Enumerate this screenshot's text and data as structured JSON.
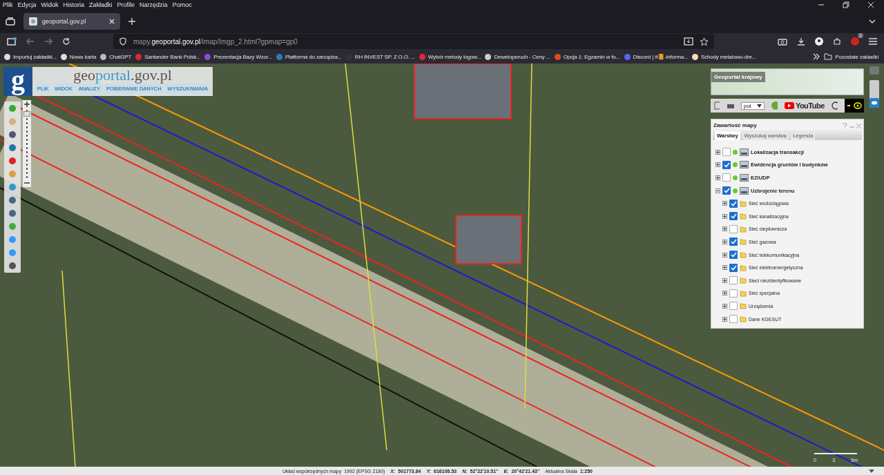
{
  "menu_bar": [
    "Plik",
    "Edycja",
    "Widok",
    "Historia",
    "Zakładki",
    "Profile",
    "Narzędzia",
    "Pomoc"
  ],
  "tabs": [
    {
      "title": "geoportal.gov.pl",
      "selected": true
    }
  ],
  "address_bar": {
    "host_prefix": "mapy.",
    "host": "geoportal.gov.pl",
    "path": "/imap/Imgp_2.html?gpmap=gp0"
  },
  "extension_badge": "2",
  "bookmarks": [
    {
      "label": "Importuj zakładki...",
      "color": "#dddddd"
    },
    {
      "label": "Nowa karta",
      "color": "#dddddd"
    },
    {
      "label": "ChatGPT",
      "color": "#bbbbbb"
    },
    {
      "label": "Santander Bank Polsk...",
      "color": "#e3262b"
    },
    {
      "label": "Prezentacja Bazy Wzor...",
      "color": "#8a4fd8"
    },
    {
      "label": "Platforma do zarządza...",
      "color": "#2a7fb8"
    },
    {
      "label": "RH INVEST SP. Z O.O. ...",
      "color": "#333333"
    },
    {
      "label": "Wybór metody logow...",
      "color": "#e3263b"
    },
    {
      "label": "Deweloperuch - Ceny ...",
      "color": "#cccccc"
    },
    {
      "label": "Opcja 1: Egzamin w fo...",
      "color": "#e64a19"
    },
    {
      "label": "Discord | #📙-informa...",
      "color": "#5865f2"
    },
    {
      "label": "Schody metalowo-dre...",
      "color": "#f0e0b0"
    }
  ],
  "other_bookmarks": "Pozostałe zakładki",
  "geoportal": {
    "logo_letter": "g",
    "site_parts": [
      "geo",
      "portal",
      ".gov.pl"
    ],
    "menu": [
      "PLIK",
      "WIDOK",
      "ANALIZY",
      "POBIERANIE DANYCH",
      "WYSZUKIWANIA"
    ]
  },
  "overview": {
    "title": "Geoportal krajowy",
    "language": "pol",
    "youtube": "YouTube"
  },
  "map_content": {
    "title": "Zawartość mapy",
    "tabs": [
      {
        "label": "Warstwy",
        "selected": true
      },
      {
        "label": "Wyszukaj warstwę",
        "selected": false
      },
      {
        "label": "Legenda",
        "selected": false
      }
    ],
    "layers": [
      {
        "name": "Lokalizacja transakcji",
        "checked": false,
        "expanded": false
      },
      {
        "name": "Ewidencja gruntów i budynków",
        "checked": true,
        "expanded": false
      },
      {
        "name": "EZiUDP",
        "checked": false,
        "expanded": false
      },
      {
        "name": "Uzbrojenie terenu",
        "checked": true,
        "expanded": true,
        "children": [
          {
            "name": "Sieć wodociągowa",
            "checked": true,
            "expanded": false
          },
          {
            "name": "Sieć kanalizacyjna",
            "checked": true,
            "expanded": false
          },
          {
            "name": "Sieć ciepłownicza",
            "checked": false,
            "expanded": false
          },
          {
            "name": "Sieć gazowa",
            "checked": true,
            "expanded": false
          },
          {
            "name": "Sieć telekomunikacyjna",
            "checked": true,
            "expanded": false
          },
          {
            "name": "Sieć elektroenergetyczna",
            "checked": true,
            "expanded": false
          },
          {
            "name": "Sieci niezidentyfikowane",
            "checked": false,
            "expanded": false
          },
          {
            "name": "Sieć specjalna",
            "checked": false,
            "expanded": false
          },
          {
            "name": "Urządzenia",
            "checked": false,
            "expanded": false
          },
          {
            "name": "Dane KGESUT",
            "checked": false,
            "expanded": false
          }
        ]
      }
    ]
  },
  "zoom": {
    "level": 0.95
  },
  "scale_bar": [
    "0",
    "3",
    "6m"
  ],
  "status_bar": [
    {
      "label": "Układ współrzędnych mapy",
      "value": "1992 (EPSG 2180)"
    },
    {
      "label": "X:",
      "value": "501773.84"
    },
    {
      "label": "Y:",
      "value": "616108.53"
    },
    {
      "label": "N:",
      "value": "52°22'10.51\""
    },
    {
      "label": "E:",
      "value": "20°42'21.43\""
    },
    {
      "label": "Aktualna Skala",
      "value": "1:250"
    }
  ]
}
